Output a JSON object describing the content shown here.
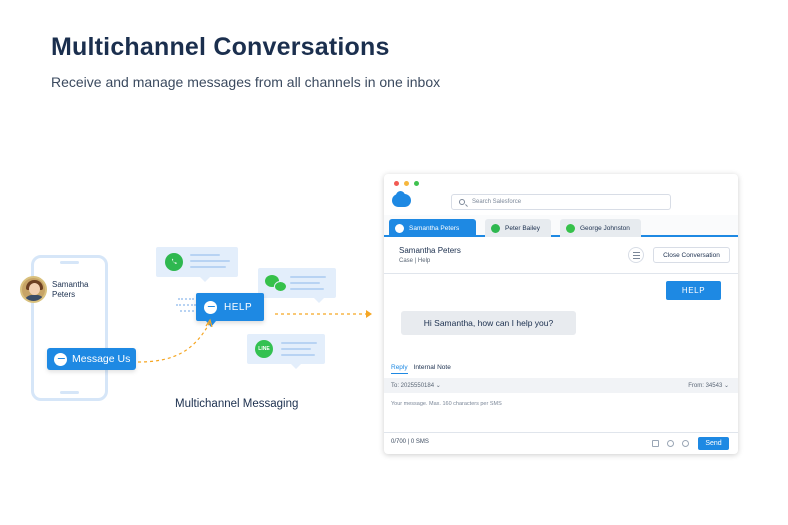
{
  "header": {
    "title": "Multichannel Conversations",
    "subtitle": "Receive and manage messages from all channels in one inbox"
  },
  "illustration": {
    "contact_name": "Samantha Peters",
    "message_us_label": "Message Us",
    "help_label": "HELP",
    "caption": "Multichannel Messaging",
    "line_label": "LINE"
  },
  "window": {
    "search_placeholder": "Search Salesforce",
    "tabs": [
      {
        "label": "Samantha Peters",
        "active": true,
        "icon": "messenger-icon"
      },
      {
        "label": "Peter Bailey",
        "active": false,
        "icon": "whatsapp-icon"
      },
      {
        "label": "George Johnston",
        "active": false,
        "icon": "wechat-icon"
      }
    ],
    "conversation": {
      "name": "Samantha Peters",
      "subtitle": "Case | Help",
      "close_label": "Close Conversation"
    },
    "messages": {
      "agent": "HELP",
      "customer": "Hi Samantha, how can I help you?"
    },
    "reply_tabs": [
      "Reply",
      "Internal Note"
    ],
    "to": "To: 2025550184",
    "from": "From: 34543",
    "compose_placeholder": "Your message. Max. 160 characters per SMS",
    "counter": "0/700  |  0 SMS",
    "send_label": "Send"
  },
  "colors": {
    "accent": "#1e89e3",
    "whatsapp": "#2fb850",
    "line": "#33c151",
    "wechat": "#36c14a"
  }
}
